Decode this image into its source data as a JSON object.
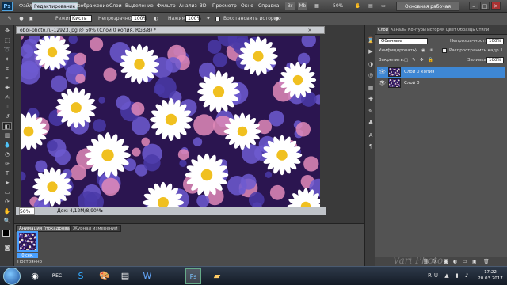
{
  "app": {
    "logo": "Ps"
  },
  "menubar": {
    "items": [
      "Файл",
      "Редактирование",
      "Изображение",
      "Слои",
      "Выделение",
      "Фильтр",
      "Анализ",
      "3D",
      "Просмотр",
      "Окно",
      "Справка"
    ],
    "selected_index": 1,
    "zoom": "50%",
    "workspace": "Основная рабочая среда",
    "window_buttons": [
      "–",
      "□",
      "✕"
    ]
  },
  "options": {
    "mode_label": "Режим:",
    "mode_value": "Кисть",
    "opacity_label": "Непрозрачность:",
    "opacity_value": "100%",
    "pressure_label": "Нажим:",
    "pressure_value": "100%",
    "erase_history_label": "Восстановить историю"
  },
  "document": {
    "tab_title": "oboi-photo.ru-12923.jpg @ 50% (Слой 0 копия, RGB/8) *",
    "close_glyph": "×",
    "status_zoom": "50%",
    "status_doc": "Док: 4,12М/8,90М"
  },
  "animation_panel": {
    "tabs": [
      "Анимация (покадровая)",
      "Журнал измерений"
    ],
    "frame_label": "0 сек.",
    "loop_label": "Постоянно"
  },
  "layers_panel": {
    "tabs": [
      "Слои",
      "Каналы",
      "Контуры",
      "История",
      "Цвет",
      "Образцы",
      "Стили"
    ],
    "blend_mode": "Обычные",
    "opacity_label": "Непрозрачность:",
    "opacity_value": "100%",
    "unify_label": "Унифицировать:",
    "propagate_label": "Распространить кадр 1",
    "lock_label": "Закрепить:",
    "fill_label": "Заливка:",
    "fill_value": "100%",
    "layers": [
      {
        "name": "Слой 0 копия",
        "selected": true
      },
      {
        "name": "Слой 0",
        "selected": false
      }
    ]
  },
  "taskbar": {
    "time": "17:22",
    "date": "20.03.2017",
    "tray": "RU ▲ ▮ ♪",
    "apps": [
      "Chrome",
      "Recorder",
      "Skype",
      "Paint",
      "Explorer",
      "Word",
      "Photoshop",
      "Folder"
    ],
    "active_app_index": 6
  },
  "watermark": "Vari Photo",
  "colors": {
    "accent": "#3e87d4",
    "panel": "#535353",
    "canvas_bg": "#2b1550",
    "daisy": "#ffffff",
    "daisy_center": "#f0c020",
    "cornflower": "#6d5bd0",
    "aster": "#e08ab8"
  }
}
